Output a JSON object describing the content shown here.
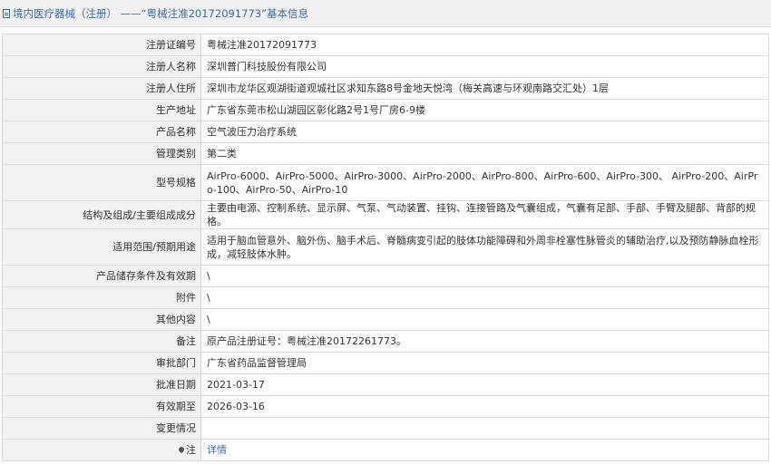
{
  "header": {
    "title": "境内医疗器械（注册） ——“粤械注准20172091773”基本信息"
  },
  "rows": [
    {
      "label": "注册证编号",
      "value": "粤械注准20172091773"
    },
    {
      "label": "注册人名称",
      "value": "深圳普门科技股份有限公司"
    },
    {
      "label": "注册人住所",
      "value": "深圳市龙华区观湖街道观城社区求知东路8号金地天悦湾（梅关高速与环观南路交汇处）1层"
    },
    {
      "label": "生产地址",
      "value": "广东省东莞市松山湖园区彰化路2号1号厂房6-9楼"
    },
    {
      "label": "产品名称",
      "value": "空气波压力治疗系统"
    },
    {
      "label": "管理类别",
      "value": "第二类"
    },
    {
      "label": "型号规格",
      "value": "AirPro-6000、AirPro-5000、AirPro-3000、AirPro-2000、AirPro-800、AirPro-600、AirPro-300、 AirPro-200、AirPro-100、AirPro-50、AirPro-10"
    },
    {
      "label": "结构及组成/主要组成成分",
      "value": "主要由电源、控制系统、显示屏、气泵、气动装置、挂钩、连接管路及气囊组成，气囊有足部、手部、手臂及腿部、背部的规格。"
    },
    {
      "label": "适用范围/预期用途",
      "value": "适用于脑血管意外、脑外伤、脑手术后、脊髓病变引起的肢体功能障碍和外周非栓塞性脉管炎的辅助治疗,以及预防静脉血栓形成，减轻肢体水肿。"
    },
    {
      "label": "产品储存条件及有效期",
      "value": "\\"
    },
    {
      "label": "附件",
      "value": "\\"
    },
    {
      "label": "其他内容",
      "value": "\\"
    },
    {
      "label": "备注",
      "value": "原产品注册证号：粤械注准20172261773。"
    },
    {
      "label": "审批部门",
      "value": "广东省药品监督管理局"
    },
    {
      "label": "批准日期",
      "value": "2021-03-17"
    },
    {
      "label": "有效期至",
      "value": "2026-03-16"
    },
    {
      "label": "变更情况",
      "value": ""
    }
  ],
  "note": {
    "label": "注",
    "link_text": "详情",
    "icon": "pin-icon"
  },
  "colors": {
    "accent": "#3f6aa8",
    "label_bg": "#f2f2f2",
    "border": "#dcdcdc"
  }
}
